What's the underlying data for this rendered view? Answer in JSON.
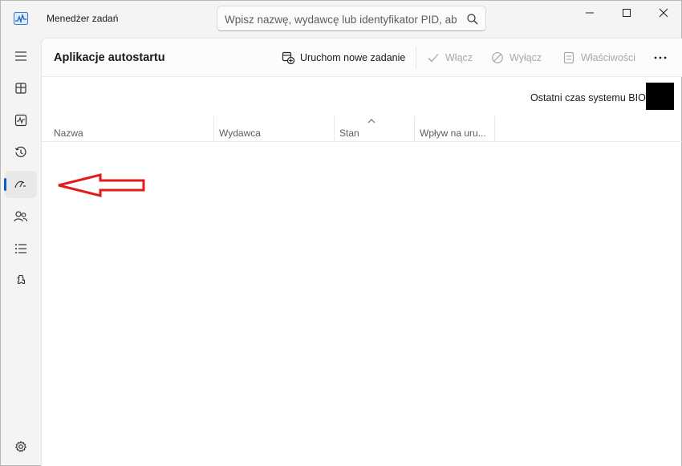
{
  "window": {
    "title": "Menedżer zadań"
  },
  "search": {
    "placeholder": "Wpisz nazwę, wydawcę lub identyfikator PID, aby wyszukać"
  },
  "sidebar": {
    "items": [
      {
        "icon": "hamburger-icon"
      },
      {
        "icon": "processes-icon"
      },
      {
        "icon": "performance-icon"
      },
      {
        "icon": "app-history-icon"
      },
      {
        "icon": "startup-apps-icon",
        "active": true
      },
      {
        "icon": "users-icon"
      },
      {
        "icon": "details-icon"
      },
      {
        "icon": "services-icon"
      },
      {
        "icon": "settings-icon"
      }
    ]
  },
  "commandbar": {
    "page_title": "Aplikacje autostartu",
    "run_new_task": "Uruchom nowe zadanie",
    "enable": "Włącz",
    "disable": "Wyłącz",
    "properties": "Właściwości"
  },
  "bios": {
    "label": "Ostatni czas systemu BIOS:"
  },
  "table": {
    "columns": [
      "Nazwa",
      "Wydawca",
      "Stan",
      "Wpływ na uru..."
    ],
    "sorted_column": "Stan"
  },
  "colors": {
    "accent": "#0a5fc7",
    "annotation_arrow": "#e21a1a"
  }
}
